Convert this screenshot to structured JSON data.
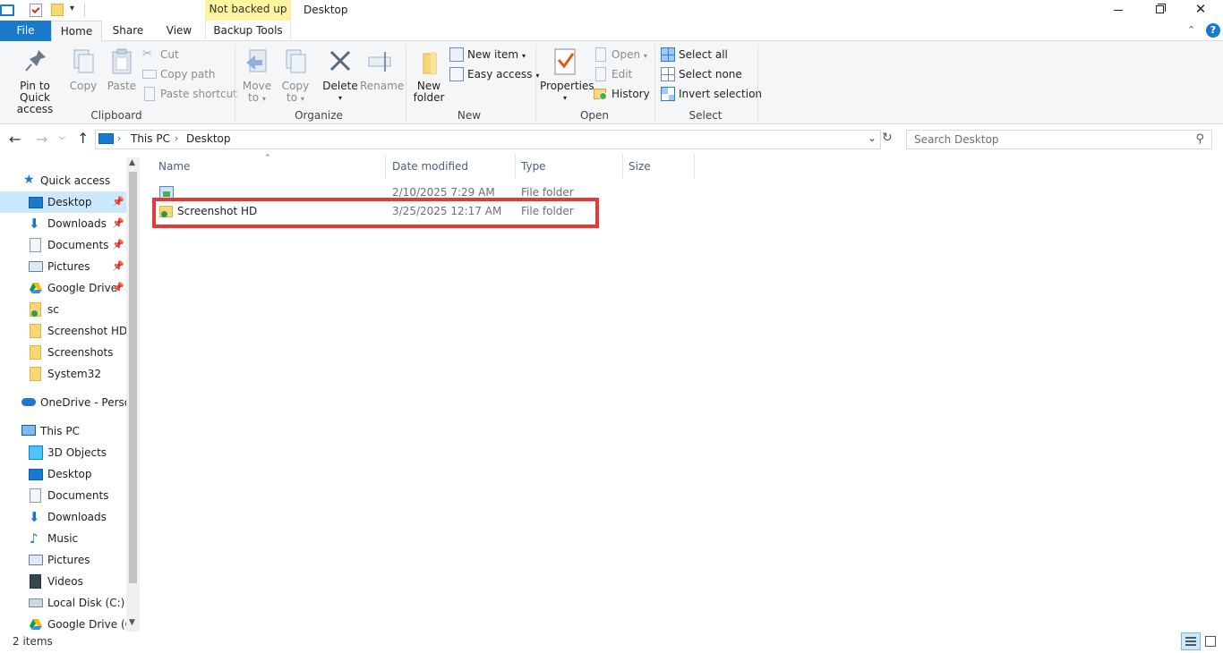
{
  "window": {
    "title": "Desktop",
    "backup_badge": "Not backed up",
    "tools_tab": "Backup Tools"
  },
  "tabs": [
    {
      "label": "File"
    },
    {
      "label": "Home"
    },
    {
      "label": "Share"
    },
    {
      "label": "View"
    }
  ],
  "ribbon": {
    "clipboard": {
      "group_label": "Clipboard",
      "pin": "Pin to Quick access",
      "pin_line1": "Pin to Quick",
      "pin_line2": "access",
      "copy": "Copy",
      "paste": "Paste",
      "cut": "Cut",
      "copy_path": "Copy path",
      "paste_shortcut": "Paste shortcut"
    },
    "organize": {
      "group_label": "Organize",
      "move_to_1": "Move",
      "move_to_2": "to",
      "copy_to_1": "Copy",
      "copy_to_2": "to",
      "delete": "Delete",
      "rename": "Rename"
    },
    "new": {
      "group_label": "New",
      "new_folder_1": "New",
      "new_folder_2": "folder",
      "new_item": "New item",
      "easy_access": "Easy access"
    },
    "open": {
      "group_label": "Open",
      "properties": "Properties",
      "open": "Open",
      "edit": "Edit",
      "history": "History"
    },
    "select": {
      "group_label": "Select",
      "select_all": "Select all",
      "select_none": "Select none",
      "invert_selection": "Invert selection"
    }
  },
  "address": {
    "crumbs": [
      "This PC",
      "Desktop"
    ],
    "search_placeholder": "Search Desktop"
  },
  "nav": {
    "quick_access": "Quick access",
    "quick_items": [
      {
        "label": "Desktop",
        "pinned": true
      },
      {
        "label": "Downloads",
        "pinned": true
      },
      {
        "label": "Documents",
        "pinned": true
      },
      {
        "label": "Pictures",
        "pinned": true
      },
      {
        "label": "Google Drive",
        "pinned": true
      },
      {
        "label": "sc",
        "pinned": false
      },
      {
        "label": "Screenshot HD",
        "pinned": false
      },
      {
        "label": "Screenshots",
        "pinned": false
      },
      {
        "label": "System32",
        "pinned": false
      }
    ],
    "onedrive": "OneDrive - Persor",
    "this_pc": "This PC",
    "pc_items": [
      {
        "label": "3D Objects"
      },
      {
        "label": "Desktop"
      },
      {
        "label": "Documents"
      },
      {
        "label": "Downloads"
      },
      {
        "label": "Music"
      },
      {
        "label": "Pictures"
      },
      {
        "label": "Videos"
      },
      {
        "label": "Local Disk (C:)"
      },
      {
        "label": "Google Drive (G:"
      }
    ]
  },
  "columns": {
    "name": "Name",
    "date": "Date modified",
    "type": "Type",
    "size": "Size"
  },
  "files": [
    {
      "name": "",
      "date": "2/10/2025 7:29 AM",
      "type": "File folder",
      "size": ""
    },
    {
      "name": "Screenshot HD",
      "date": "3/25/2025 12:17 AM",
      "type": "File folder",
      "size": ""
    }
  ],
  "status": {
    "count": "2 items"
  },
  "colors": {
    "file_tab": "#1979ca",
    "highlight_box": "#e53935",
    "badge_bg": "#fdf4a0",
    "selection": "#cce8ff"
  }
}
